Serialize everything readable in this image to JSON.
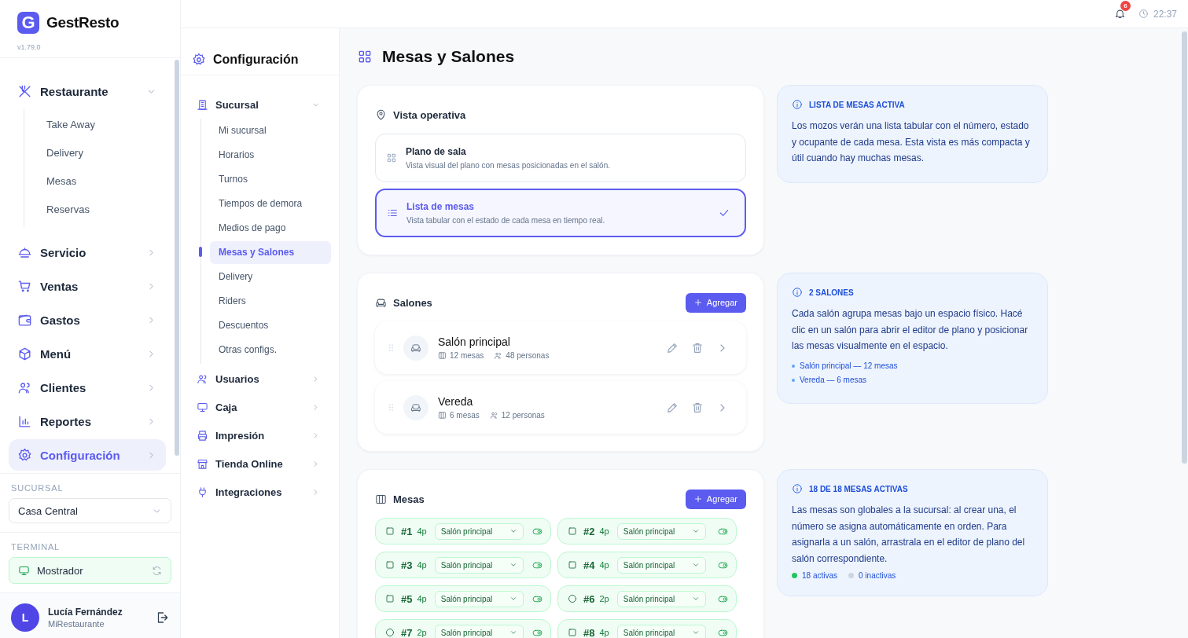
{
  "app": {
    "logo_letter": "G",
    "name": "GestResto",
    "version": "v1.79.0"
  },
  "sidebar": {
    "items": [
      {
        "label": "Restaurante",
        "selected": false,
        "expanded": true,
        "children": [
          {
            "label": "Take Away",
            "selected": false
          },
          {
            "label": "Delivery",
            "selected": false
          },
          {
            "label": "Mesas",
            "selected": false
          },
          {
            "label": "Reservas",
            "selected": false
          }
        ]
      },
      {
        "label": "Servicio",
        "selected": false,
        "expanded": false
      },
      {
        "label": "Ventas",
        "selected": false,
        "expanded": false
      },
      {
        "label": "Gastos",
        "selected": false,
        "expanded": false
      },
      {
        "label": "Menú",
        "selected": false,
        "expanded": false
      },
      {
        "label": "Clientes",
        "selected": false,
        "expanded": false
      },
      {
        "label": "Reportes",
        "selected": false,
        "expanded": false
      },
      {
        "label": "Configuración",
        "selected": true,
        "expanded": false
      }
    ]
  },
  "branch": {
    "heading": "SUCURSAL",
    "value": "Casa Central"
  },
  "terminal": {
    "heading": "TERMINAL",
    "value": "Mostrador"
  },
  "user": {
    "initial": "L",
    "name": "Lucía Fernández",
    "org": "MiRestaurante"
  },
  "topbar": {
    "notifications": "6",
    "time": "22:37"
  },
  "config_nav": {
    "title": "Configuración",
    "items": [
      {
        "label": "Sucursal",
        "expanded": true,
        "children": [
          {
            "label": "Mi sucursal",
            "selected": false
          },
          {
            "label": "Horarios",
            "selected": false
          },
          {
            "label": "Turnos",
            "selected": false
          },
          {
            "label": "Tiempos de demora",
            "selected": false
          },
          {
            "label": "Medios de pago",
            "selected": false
          },
          {
            "label": "Mesas y Salones",
            "selected": true
          },
          {
            "label": "Delivery",
            "selected": false
          },
          {
            "label": "Riders",
            "selected": false
          },
          {
            "label": "Descuentos",
            "selected": false
          },
          {
            "label": "Otras configs.",
            "selected": false
          }
        ]
      },
      {
        "label": "Usuarios",
        "expanded": false
      },
      {
        "label": "Caja",
        "expanded": false
      },
      {
        "label": "Impresión",
        "expanded": false
      },
      {
        "label": "Tienda Online",
        "expanded": false
      },
      {
        "label": "Integraciones",
        "expanded": false
      }
    ]
  },
  "page": {
    "title": "Mesas y Salones"
  },
  "vista": {
    "title": "Vista operativa",
    "options": [
      {
        "title": "Plano de sala",
        "description": "Vista visual del plano con mesas posicionadas en el salón.",
        "selected": false
      },
      {
        "title": "Lista de mesas",
        "description": "Vista tabular con el estado de cada mesa en tiempo real.",
        "selected": true
      }
    ]
  },
  "salones": {
    "title": "Salones",
    "add_label": "Agregar",
    "items": [
      {
        "name": "Salón principal",
        "tables": "12 mesas",
        "people": "48 personas"
      },
      {
        "name": "Vereda",
        "tables": "6 mesas",
        "people": "12 personas"
      }
    ]
  },
  "mesas": {
    "title": "Mesas",
    "add_label": "Agregar",
    "items": [
      {
        "number": "#1",
        "capacity": "4p",
        "room": "Salón principal",
        "kind": "square",
        "on": true
      },
      {
        "number": "#2",
        "capacity": "4p",
        "room": "Salón principal",
        "kind": "square",
        "on": true
      },
      {
        "number": "#3",
        "capacity": "4p",
        "room": "Salón principal",
        "kind": "square",
        "on": true
      },
      {
        "number": "#4",
        "capacity": "4p",
        "room": "Salón principal",
        "kind": "square",
        "on": true
      },
      {
        "number": "#5",
        "capacity": "4p",
        "room": "Salón principal",
        "kind": "square",
        "on": true
      },
      {
        "number": "#6",
        "capacity": "2p",
        "room": "Salón principal",
        "kind": "round",
        "on": true
      },
      {
        "number": "#7",
        "capacity": "2p",
        "room": "Salón principal",
        "kind": "round",
        "on": true
      },
      {
        "number": "#8",
        "capacity": "4p",
        "room": "Salón principal",
        "kind": "square",
        "on": true
      }
    ]
  },
  "info": [
    {
      "title": "LISTA DE MESAS ACTIVA",
      "text": "Los mozos verán una lista tabular con el número, estado y ocupante de cada mesa. Esta vista es más compacta y útil cuando hay muchas mesas."
    },
    {
      "title": "2 SALONES",
      "text": "Cada salón agrupa mesas bajo un espacio físico. Hacé clic en un salón para abrir el editor de plano y posicionar las mesas visualmente en el espacio.",
      "bullets": [
        "Salón principal — 12 mesas",
        "Vereda — 6 mesas"
      ]
    },
    {
      "title": "18 DE 18 MESAS ACTIVAS",
      "text": "Las mesas son globales a la sucursal: al crear una, el número se asigna automáticamente en orden. Para asignarla a un salón, arrastrala en el editor de plano del salón correspondiente.",
      "legend": [
        {
          "label": "18 activas",
          "color": "#22c55e"
        },
        {
          "label": "0 inactivas",
          "color": "#cbd5e1"
        }
      ]
    }
  ]
}
